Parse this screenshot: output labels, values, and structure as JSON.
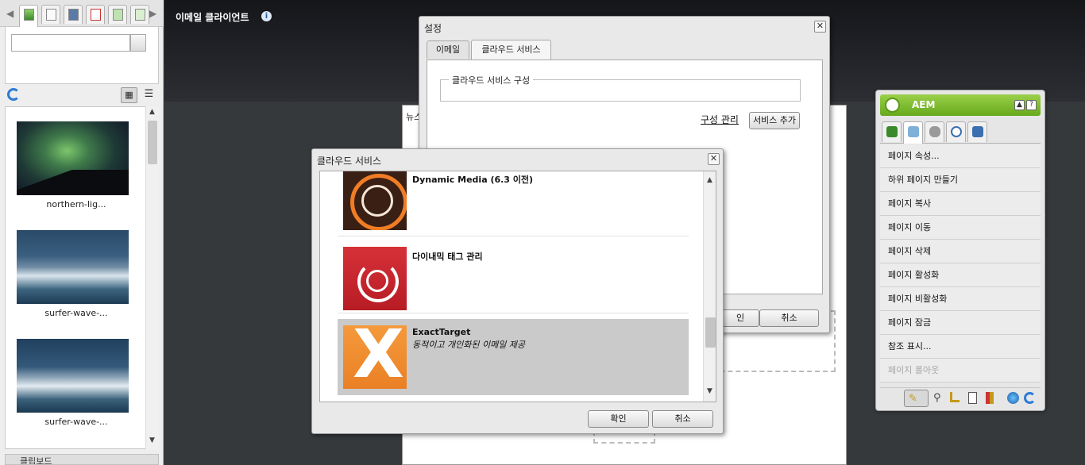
{
  "app": {
    "title": "이메일 클라이언트"
  },
  "finder": {
    "search": {
      "value": "",
      "placeholder": ""
    },
    "tabs": [
      "images-tab",
      "documents-tab",
      "movies-tab",
      "s7-tab",
      "pages-tab",
      "paragraphs-tab"
    ],
    "assets": [
      {
        "label": "northern-lig..."
      },
      {
        "label": "surfer-wave-..."
      },
      {
        "label": "surfer-wave-..."
      }
    ],
    "clipboard_label": "클립보드"
  },
  "canvas": {
    "label_fragment": "뉴스"
  },
  "settings_dialog": {
    "title": "설정",
    "tabs": [
      {
        "label": "이메일"
      },
      {
        "label": "클라우드 서비스"
      }
    ],
    "active_tab": "클라우드 서비스",
    "fieldset_legend": "클라우드 서비스 구성",
    "manage_link": "구성 관리",
    "add_service": "서비스 추가",
    "ok_partial": "인",
    "cancel": "취소"
  },
  "cloud_dialog": {
    "title": "클라우드 서비스",
    "services": [
      {
        "name": "Dynamic Media (6.3 이전)",
        "description": "",
        "icon": "dynamic-media-icon",
        "selected": false
      },
      {
        "name": "다이내믹 태그 관리",
        "description": "",
        "icon": "dynamic-tag-management-icon",
        "selected": false
      },
      {
        "name": "ExactTarget",
        "description": "동적이고 개인화된 이메일 제공",
        "icon": "exacttarget-icon",
        "selected": true
      }
    ],
    "ok": "확인",
    "cancel": "취소"
  },
  "sidekick": {
    "title": "AEM",
    "items": [
      {
        "label": "페이지 속성...",
        "enabled": true
      },
      {
        "label": "하위 페이지 만들기",
        "enabled": true
      },
      {
        "label": "페이지 복사",
        "enabled": true
      },
      {
        "label": "페이지 이동",
        "enabled": true
      },
      {
        "label": "페이지 삭제",
        "enabled": true
      },
      {
        "label": "페이지 활성화",
        "enabled": true
      },
      {
        "label": "페이지 비활성화",
        "enabled": true
      },
      {
        "label": "페이지 잠금",
        "enabled": true
      },
      {
        "label": "참조 표시...",
        "enabled": true
      },
      {
        "label": "페이지 롤아웃",
        "enabled": false
      }
    ]
  },
  "colors": {
    "aem_green": "#7fbf2e",
    "exacttarget_orange": "#ef8a2f",
    "selection_gray": "#cacaca"
  }
}
